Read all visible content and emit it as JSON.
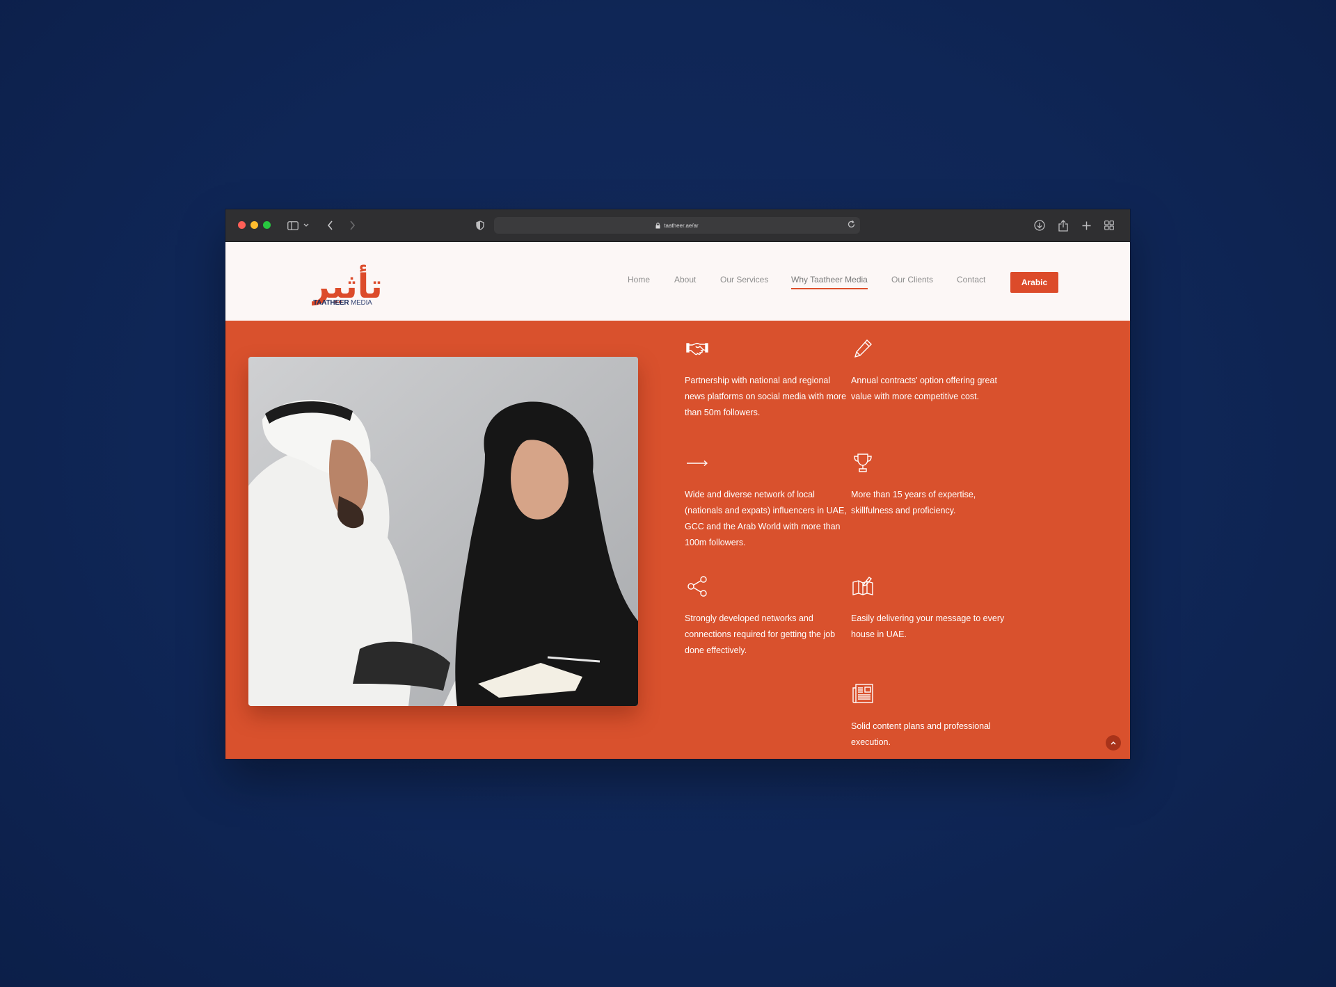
{
  "browser": {
    "url": "taatheer.ae/ar"
  },
  "site": {
    "logo_arabic": "تأثير",
    "logo_brand": "TAATHEER",
    "logo_suffix": "MEDIA",
    "nav": [
      {
        "label": "Home"
      },
      {
        "label": "About"
      },
      {
        "label": "Our Services"
      },
      {
        "label": "Why Taatheer Media",
        "active": true
      },
      {
        "label": "Our Clients"
      },
      {
        "label": "Contact"
      }
    ],
    "language_button": "Arabic"
  },
  "features": [
    {
      "icon": "handshake-icon",
      "text": "Partnership with national and regional news platforms on social media with more than 50m followers."
    },
    {
      "icon": "pencil-icon",
      "text": "Annual contracts' option offering great value with more competitive cost."
    },
    {
      "icon": "arrow-right-icon",
      "text": "Wide and diverse network of local (nationals and expats) influencers in UAE, GCC and the Arab World with more than 100m followers."
    },
    {
      "icon": "trophy-icon",
      "text": "More than 15 years of expertise, skillfulness and proficiency."
    },
    {
      "icon": "share-icon",
      "text": "Strongly developed networks and connections required for getting the job done effectively."
    },
    {
      "icon": "map-icon",
      "text": "Easily delivering your message to every house in UAE."
    },
    {
      "icon": "newspaper-icon",
      "text": "Solid content plans and professional execution."
    }
  ],
  "colors": {
    "page_background": "#0f2656",
    "accent": "#dc4b2a",
    "hero_background": "#d9512d",
    "header_background": "#fcf7f6",
    "logo_blue": "#1c2c5c"
  }
}
